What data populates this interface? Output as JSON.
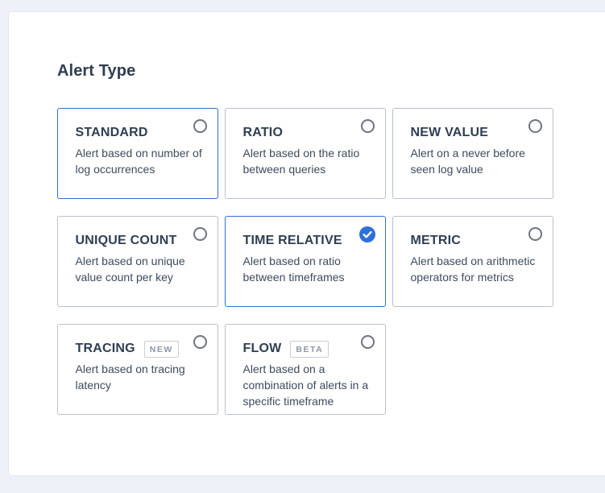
{
  "section": {
    "title": "Alert Type"
  },
  "alert_types": [
    {
      "title": "STANDARD",
      "description": "Alert based on number of log occurrences",
      "badge": "",
      "selected": false
    },
    {
      "title": "RATIO",
      "description": "Alert based on the ratio between queries",
      "badge": "",
      "selected": false
    },
    {
      "title": "NEW VALUE",
      "description": "Alert on a never before seen log value",
      "badge": "",
      "selected": false
    },
    {
      "title": "UNIQUE COUNT",
      "description": "Alert based on unique value count per key",
      "badge": "",
      "selected": false
    },
    {
      "title": "TIME RELATIVE",
      "description": "Alert based on ratio between timeframes",
      "badge": "",
      "selected": true
    },
    {
      "title": "METRIC",
      "description": "Alert based on arithmetic operators for metrics",
      "badge": "",
      "selected": false
    },
    {
      "title": "TRACING",
      "description": "Alert based on tracing latency",
      "badge": "NEW",
      "selected": false
    },
    {
      "title": "FLOW",
      "description": "Alert based on a combination of alerts in a specific timeframe",
      "badge": "BETA",
      "selected": false
    }
  ],
  "colors": {
    "accent": "#2f6fdb",
    "card_border": "#b9c1cc",
    "title_text": "#2f3e52",
    "page_background": "#eef1f8"
  },
  "icons": {
    "unchecked": "radio-unchecked-icon",
    "checked": "radio-checked-icon"
  }
}
